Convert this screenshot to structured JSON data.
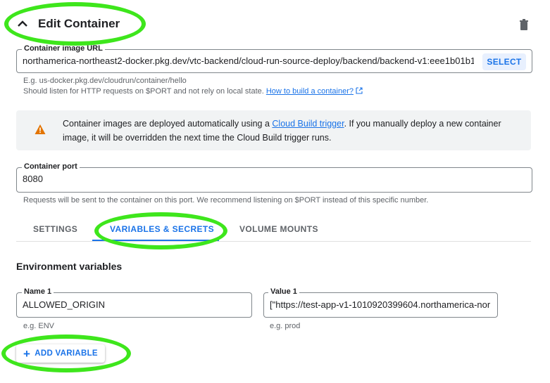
{
  "header": {
    "title": "Edit Container",
    "collapse_icon": "chevron-up-icon",
    "delete_icon": "trash-icon"
  },
  "image_url": {
    "label": "Container image URL",
    "value": "northamerica-northeast2-docker.pkg.dev/vtc-backend/cloud-run-source-deploy/backend/backend-v1:eee1b01b1",
    "select_label": "SELECT",
    "hint_example": "E.g. us-docker.pkg.dev/cloudrun/container/hello",
    "hint_text": "Should listen for HTTP requests on $PORT and not rely on local state.",
    "hint_link": "How to build a container?"
  },
  "banner": {
    "text_before": "Container images are deployed automatically using a",
    "link": "Cloud Build trigger",
    "text_after": ". If you manually deploy a new container image, it will be overridden the next time the Cloud Build trigger runs."
  },
  "port": {
    "label": "Container port",
    "value": "8080",
    "hint": "Requests will be sent to the container on this port. We recommend listening on $PORT instead of this specific number."
  },
  "tabs": [
    {
      "label": "SETTINGS"
    },
    {
      "label": "VARIABLES & SECRETS"
    },
    {
      "label": "VOLUME MOUNTS"
    }
  ],
  "env": {
    "title": "Environment variables",
    "name_label": "Name 1",
    "name_value": "ALLOWED_ORIGIN",
    "name_hint": "e.g. ENV",
    "value_label": "Value 1",
    "value_value": "[\"https://test-app-v1-1010920399604.northamerica-nor",
    "value_hint": "e.g. prod",
    "add_label": "ADD VARIABLE"
  },
  "colors": {
    "accent": "#1a73e8",
    "highlight": "#3ee61c",
    "warning": "#e37400"
  }
}
